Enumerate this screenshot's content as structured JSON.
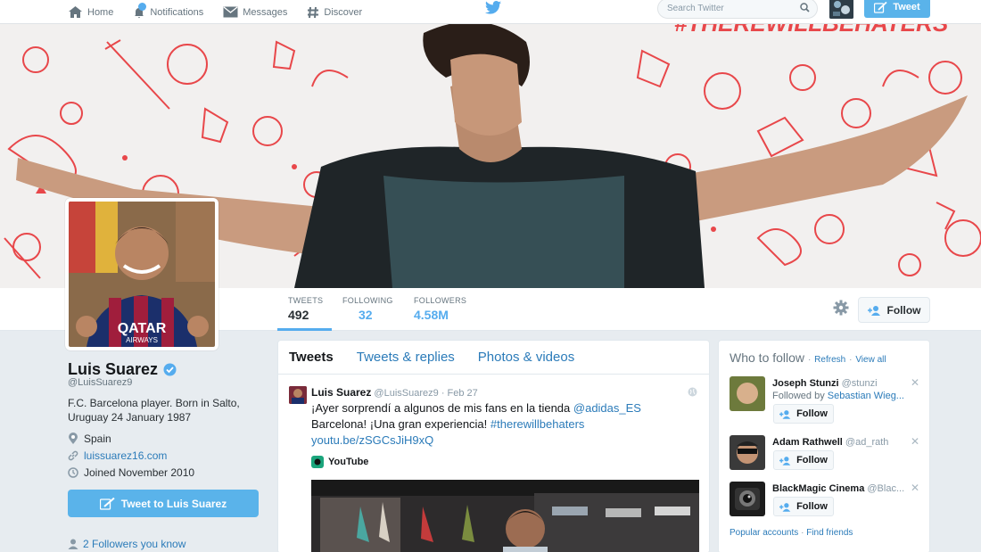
{
  "nav": {
    "home": "Home",
    "notifications": "Notifications",
    "messages": "Messages",
    "discover": "Discover",
    "search_placeholder": "Search Twitter",
    "tweet_button": "Tweet"
  },
  "banner": {
    "hashtag": "#THEREWILLBEHATERS"
  },
  "stats": [
    {
      "label": "TWEETS",
      "value": "492"
    },
    {
      "label": "FOLLOWING",
      "value": "32"
    },
    {
      "label": "FOLLOWERS",
      "value": "4.58M"
    }
  ],
  "profile": {
    "name": "Luis Suarez",
    "handle": "@LuisSuarez9",
    "bio": "F.C. Barcelona player. Born in Salto, Uruguay 24 January 1987",
    "location": "Spain",
    "website": "luissuarez16.com",
    "joined": "Joined November 2010",
    "follow_label": "Follow",
    "tweet_to": "Tweet to Luis Suarez",
    "followers_you_know": "2 Followers you know",
    "jersey_sponsor": "QATAR",
    "jersey_sponsor_sub": "AIRWAYS"
  },
  "timeline": {
    "tabs": [
      "Tweets",
      "Tweets & replies",
      "Photos & videos"
    ],
    "tweet": {
      "name": "Luis Suarez",
      "handle": "@LuisSuarez9",
      "date": "· Feb 27",
      "text_1": "¡Ayer sorprendí a algunos de mis fans en la tienda ",
      "mention": "@adidas_ES",
      "text_2": "Barcelona! ¡Una gran experiencia! ",
      "hashtag": "#therewillbehaters",
      "link": "youtu.be/zSGCsJiH9xQ",
      "card_source": "YouTube"
    }
  },
  "who_to_follow": {
    "title": "Who to follow",
    "refresh": "Refresh",
    "view_all": "View all",
    "dot": "·",
    "items": [
      {
        "name": "Joseph Stunzi",
        "handle": "@stunzi",
        "sub": "Followed by ",
        "sub_link": "Sebastian Wieg...",
        "follow": "Follow"
      },
      {
        "name": "Adam Rathwell",
        "handle": "@ad_rath",
        "sub": "",
        "sub_link": "",
        "follow": "Follow"
      },
      {
        "name": "BlackMagic Cinema",
        "handle": "@Blac...",
        "sub": "",
        "sub_link": "",
        "follow": "Follow"
      }
    ],
    "popular": "Popular accounts",
    "find_friends": "Find friends"
  },
  "colors": {
    "accent": "#55acee",
    "link": "#2b7bb9",
    "banner_doodle": "#e8474a"
  }
}
